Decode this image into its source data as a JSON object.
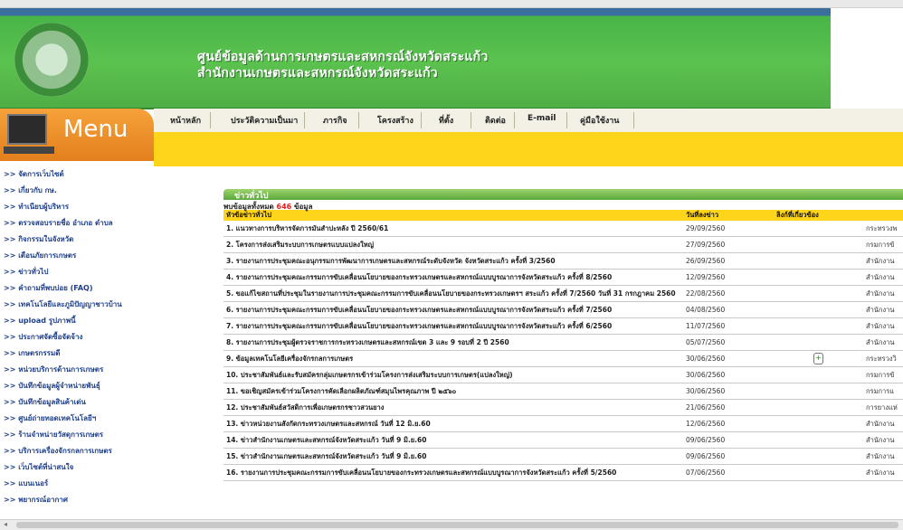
{
  "header": {
    "title_line1": "ศูนย์ข้อมูลด้านการเกษตรและสหกรณ์จังหวัดสระแก้ว",
    "title_line2": "สำนักงานเกษตรและสหกรณ์จังหวัดสระแก้ว"
  },
  "menu": {
    "label": "Menu"
  },
  "nav": [
    "หน้าหลัก",
    "ประวัติความเป็นมา",
    "ภารกิจ",
    "โครงสร้าง",
    "ที่ตั้ง",
    "ติดต่อ",
    "E-mail",
    "คู่มือใช้งาน"
  ],
  "sidebar": [
    ">> จัดการเว็บไซต์",
    ">> เกี่ยวกับ กษ.",
    ">> ทำเนียบผู้บริหาร",
    ">> ตรวจสอบรายชื่อ อำเภอ ตำบล",
    ">> กิจกรรมในจังหวัด",
    ">> เตือนภัยการเกษตร",
    ">> ข่าวทั่วไป",
    ">> คำถามที่พบบ่อย (FAQ)",
    ">> เทคโนโลยีและภูมิปัญญาชาวบ้าน",
    ">> upload รูปภาพนี้",
    ">> ประกาศจัดซื้อจัดจ้าง",
    ">> เกษตรกรรมดี",
    ">> หน่วยบริการด้านการเกษตร",
    ">> บันทึกข้อมูลผู้จำหน่ายพันธุ์",
    ">> บันทึกข้อมูลสินค้าเด่น",
    ">> ศูนย์ถ่ายทอดเทคโนโลยีฯ",
    ">> ร้านจำหน่ายวัสดุการเกษตร",
    ">> บริการเครื่องจักรกลการเกษตร",
    ">> เว็บไซต์ที่น่าสนใจ",
    ">> แบนเนอร์",
    ">> พยากรณ์อากาศ"
  ],
  "news": {
    "heading": "ข่าวทั่วไป",
    "count_prefix": "พบข้อมูลทั้งหมด",
    "count": "646",
    "count_suffix": "ข้อมูล",
    "columns": [
      "หัวข้อข่าวทั่วไป",
      "วันที่ลงข่าว",
      "ลิงก์ที่เกี่ยวข้อง",
      ""
    ],
    "rows": [
      {
        "title": "1. แนวทางการบริหารจัดการมันสำปะหลัง ปี 2560/61",
        "date": "29/09/2560",
        "src": "กระทรวงพ"
      },
      {
        "title": "2. โครงการส่งเสริมระบบการเกษตรแบบแปลงใหญ่",
        "date": "27/09/2560",
        "src": "กรมการข้"
      },
      {
        "title": "3. รายงานการประชุมคณะอนุกรรมการพัฒนาการเกษตรและสหกรณ์ระดับจังหวัด จังหวัดสระแก้ว ครั้งที่ 3/2560",
        "date": "26/09/2560",
        "src": "สำนักงาน"
      },
      {
        "title": "4. รายงานการประชุมคณะกรรมการขับเคลื่อนนโยบายของกระทรวงเกษตรและสหกรณ์แบบบูรณาการจังหวัดสระแก้ว ครั้งที่ 8/2560",
        "date": "12/09/2560",
        "src": "สำนักงาน"
      },
      {
        "title": "5. ขอแก้ไขสถานที่ประชุมในรายงานการประชุมคณะกรรมการขับเคลื่อนนโยบายของกระทรวงเกษตรฯ สระแก้ว ครั้งที่ 7/2560 วันที่ 31 กรกฎาคม 2560",
        "date": "22/08/2560",
        "src": "สำนักงาน"
      },
      {
        "title": "6. รายงานการประชุมคณะกรรมการขับเคลื่อนนโยบายของกระทรวงเกษตรและสหกรณ์แบบบูรณาการจังหวัดสระแก้ว ครั้งที่ 7/2560",
        "date": "04/08/2560",
        "src": "สำนักงาน"
      },
      {
        "title": "7. รายงานการประชุมคณะกรรมการขับเคลื่อนนโยบายของกระทรวงเกษตรและสหกรณ์แบบบูรณาการจังหวัดสระแก้ว ครั้งที่ 6/2560",
        "date": "11/07/2560",
        "src": "สำนักงาน"
      },
      {
        "title": "8. รายงานการประชุมผู้ตรวจราชการกระทรวงเกษตรและสหกรณ์เขต 3 และ 9 รอบที่ 2 ปี 2560",
        "date": "05/07/2560",
        "src": "สำนักงาน"
      },
      {
        "title": "9. ข้อมูลเทคโนโลยีเครื่องจักรกลการเกษตร",
        "date": "30/06/2560",
        "src": "กระทรวงวิ"
      },
      {
        "title": "10. ประชาสัมพันธ์และรับสมัครกลุ่มเกษตรกรเข้าร่วมโครงการส่งเสริมระบบการเกษตร(แปลงใหญ่)",
        "date": "30/06/2560",
        "src": "กรมการข้"
      },
      {
        "title": "11. ขอเชิญสมัครเข้าร่วมโครงการคัดเลือกผลิตภัณฑ์สมุนไพรคุณภาพ ปี ๒๕๖๐",
        "date": "30/06/2560",
        "src": "กรมการแ"
      },
      {
        "title": "12. ประชาสัมพันธ์สวัสดิการเพื่อเกษตรกรชาวสวนยาง",
        "date": "21/06/2560",
        "src": "การยางแห่"
      },
      {
        "title": "13. ข่าวหน่วยงานสังกัดกระทรวงเกษตรและสหกรณ์ วันที่ 12 มิ.ย.60",
        "date": "12/06/2560",
        "src": "สำนักงาน"
      },
      {
        "title": "14. ข่าวสำนักงานเกษตรและสหกรณ์จังหวัดสระแก้ว วันที่ 9 มิ.ย.60",
        "date": "09/06/2560",
        "src": "สำนักงาน"
      },
      {
        "title": "15. ข่าวสำนักงานเกษตรและสหกรณ์จังหวัดสระแก้ว วันที่ 9 มิ.ย.60",
        "date": "09/06/2560",
        "src": "สำนักงาน"
      },
      {
        "title": "16. รายงานการประชุมคณะกรรมการขับเคลื่อนนโยบายของกระทรวงเกษตรและสหกรณ์แบบบูรณาการจังหวัดสระแก้ว ครั้งที่ 5/2560",
        "date": "07/06/2560",
        "src": "สำนักงาน"
      }
    ]
  }
}
